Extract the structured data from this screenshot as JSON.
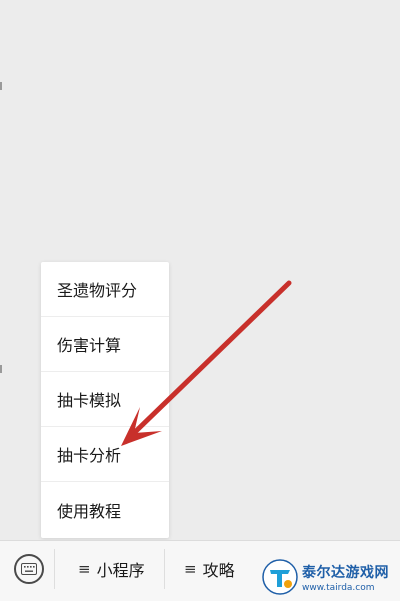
{
  "menu": {
    "items": [
      {
        "label": "圣遗物评分"
      },
      {
        "label": "伤害计算"
      },
      {
        "label": "抽卡模拟"
      },
      {
        "label": "抽卡分析"
      },
      {
        "label": "使用教程"
      }
    ]
  },
  "bottom_bar": {
    "keyboard_icon": "keyboard-icon",
    "tabs": [
      {
        "icon": "menu-icon",
        "label": "小程序"
      },
      {
        "icon": "menu-icon",
        "label": "攻略"
      }
    ]
  },
  "annotation": {
    "arrow_color": "#c8302b"
  },
  "watermark": {
    "title": "泰尔达游戏网",
    "url": "www.tairda.com"
  }
}
